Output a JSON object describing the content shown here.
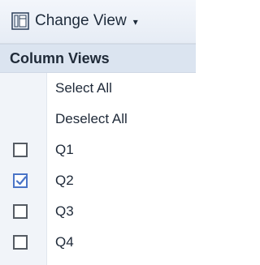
{
  "toolbar": {
    "change_view_label": "Change View",
    "view_icon": "view-columns-icon",
    "dropdown_icon": "caret-down-icon"
  },
  "menu": {
    "section_title": "Column Views",
    "actions": [
      {
        "label": "Select All"
      },
      {
        "label": "Deselect All"
      }
    ],
    "items": [
      {
        "label": "Q1",
        "checked": false
      },
      {
        "label": "Q2",
        "checked": true
      },
      {
        "label": "Q3",
        "checked": false
      },
      {
        "label": "Q4",
        "checked": false
      }
    ]
  },
  "colors": {
    "accent": "#4a74c7",
    "header_bg": "#dbe4f0",
    "gutter_bg": "#f1f4f9"
  }
}
